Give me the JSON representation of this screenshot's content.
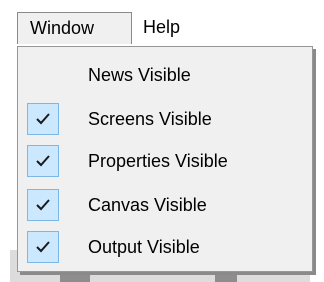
{
  "menubar": {
    "items": [
      {
        "label": "Window"
      },
      {
        "label": "Help"
      }
    ]
  },
  "dropdown": {
    "items": [
      {
        "label": "News Visible",
        "checked": false
      },
      {
        "label": "Screens Visible",
        "checked": true,
        "icon": "check-icon"
      },
      {
        "label": "Properties Visible",
        "checked": true,
        "icon": "check-icon"
      },
      {
        "label": "Canvas Visible",
        "checked": true,
        "icon": "check-icon"
      },
      {
        "label": "Output Visible",
        "checked": true,
        "icon": "check-icon"
      }
    ]
  },
  "colors": {
    "menu_background": "#f0f0f0",
    "checkbox_background": "#cce8ff",
    "checkbox_border": "#7ab8ea",
    "check_color": "#1a1a1a"
  }
}
